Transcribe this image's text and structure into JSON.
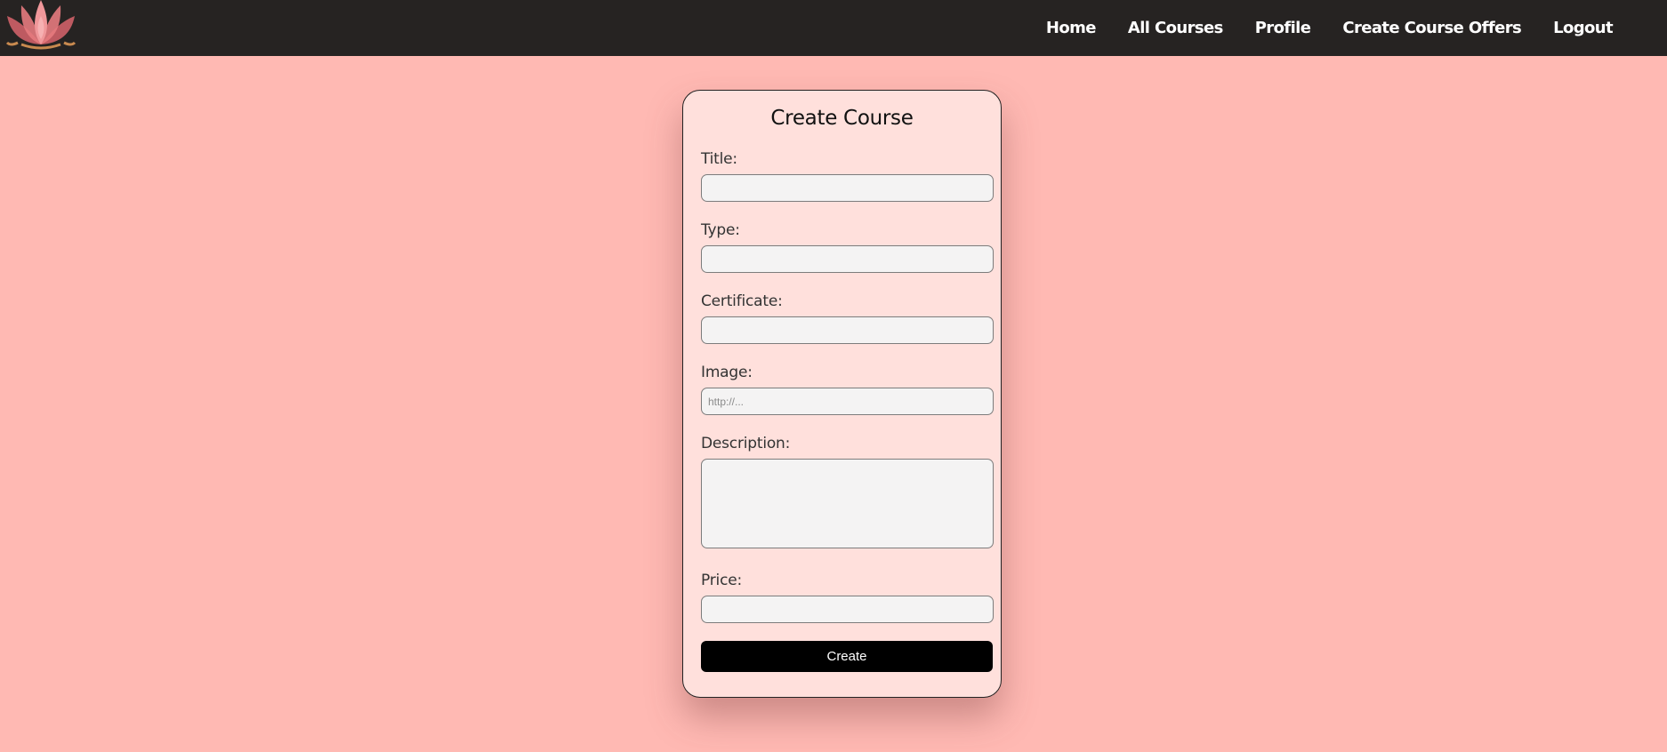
{
  "nav": {
    "logo": "lotus-logo",
    "links": [
      "Home",
      "All Courses",
      "Profile",
      "Create Course Offers",
      "Logout"
    ]
  },
  "form": {
    "title": "Create Course",
    "fields": {
      "title": {
        "label": "Title:",
        "value": "",
        "placeholder": ""
      },
      "type": {
        "label": "Type:",
        "value": "",
        "placeholder": ""
      },
      "certificate": {
        "label": "Certificate:",
        "value": "",
        "placeholder": ""
      },
      "image": {
        "label": "Image:",
        "value": "",
        "placeholder": "http://..."
      },
      "description": {
        "label": "Description:",
        "value": "",
        "placeholder": ""
      },
      "price": {
        "label": "Price:",
        "value": "",
        "placeholder": ""
      }
    },
    "submit_label": "Create"
  },
  "colors": {
    "page_background": "#ffb9b3",
    "navbar": "#262322",
    "card": "#ffe0dc",
    "button": "#000000"
  }
}
